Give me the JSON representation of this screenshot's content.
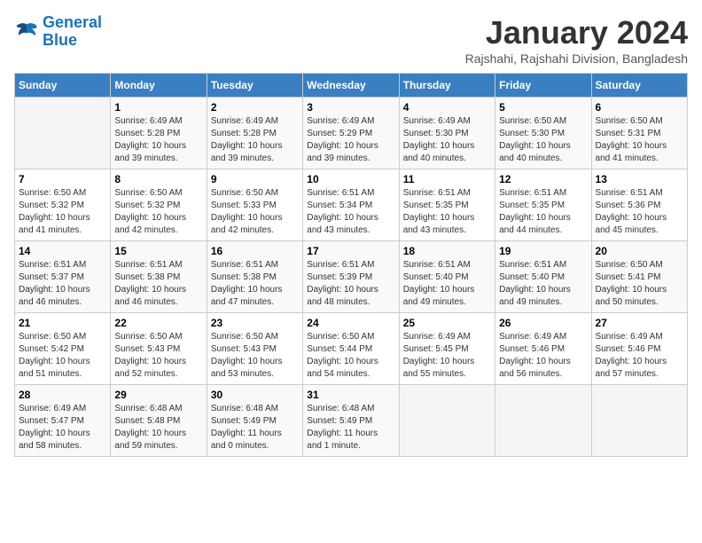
{
  "header": {
    "logo_line1": "General",
    "logo_line2": "Blue",
    "title": "January 2024",
    "subtitle": "Rajshahi, Rajshahi Division, Bangladesh"
  },
  "weekdays": [
    "Sunday",
    "Monday",
    "Tuesday",
    "Wednesday",
    "Thursday",
    "Friday",
    "Saturday"
  ],
  "weeks": [
    [
      {
        "day": "",
        "info": ""
      },
      {
        "day": "1",
        "info": "Sunrise: 6:49 AM\nSunset: 5:28 PM\nDaylight: 10 hours\nand 39 minutes."
      },
      {
        "day": "2",
        "info": "Sunrise: 6:49 AM\nSunset: 5:28 PM\nDaylight: 10 hours\nand 39 minutes."
      },
      {
        "day": "3",
        "info": "Sunrise: 6:49 AM\nSunset: 5:29 PM\nDaylight: 10 hours\nand 39 minutes."
      },
      {
        "day": "4",
        "info": "Sunrise: 6:49 AM\nSunset: 5:30 PM\nDaylight: 10 hours\nand 40 minutes."
      },
      {
        "day": "5",
        "info": "Sunrise: 6:50 AM\nSunset: 5:30 PM\nDaylight: 10 hours\nand 40 minutes."
      },
      {
        "day": "6",
        "info": "Sunrise: 6:50 AM\nSunset: 5:31 PM\nDaylight: 10 hours\nand 41 minutes."
      }
    ],
    [
      {
        "day": "7",
        "info": "Sunrise: 6:50 AM\nSunset: 5:32 PM\nDaylight: 10 hours\nand 41 minutes."
      },
      {
        "day": "8",
        "info": "Sunrise: 6:50 AM\nSunset: 5:32 PM\nDaylight: 10 hours\nand 42 minutes."
      },
      {
        "day": "9",
        "info": "Sunrise: 6:50 AM\nSunset: 5:33 PM\nDaylight: 10 hours\nand 42 minutes."
      },
      {
        "day": "10",
        "info": "Sunrise: 6:51 AM\nSunset: 5:34 PM\nDaylight: 10 hours\nand 43 minutes."
      },
      {
        "day": "11",
        "info": "Sunrise: 6:51 AM\nSunset: 5:35 PM\nDaylight: 10 hours\nand 43 minutes."
      },
      {
        "day": "12",
        "info": "Sunrise: 6:51 AM\nSunset: 5:35 PM\nDaylight: 10 hours\nand 44 minutes."
      },
      {
        "day": "13",
        "info": "Sunrise: 6:51 AM\nSunset: 5:36 PM\nDaylight: 10 hours\nand 45 minutes."
      }
    ],
    [
      {
        "day": "14",
        "info": "Sunrise: 6:51 AM\nSunset: 5:37 PM\nDaylight: 10 hours\nand 46 minutes."
      },
      {
        "day": "15",
        "info": "Sunrise: 6:51 AM\nSunset: 5:38 PM\nDaylight: 10 hours\nand 46 minutes."
      },
      {
        "day": "16",
        "info": "Sunrise: 6:51 AM\nSunset: 5:38 PM\nDaylight: 10 hours\nand 47 minutes."
      },
      {
        "day": "17",
        "info": "Sunrise: 6:51 AM\nSunset: 5:39 PM\nDaylight: 10 hours\nand 48 minutes."
      },
      {
        "day": "18",
        "info": "Sunrise: 6:51 AM\nSunset: 5:40 PM\nDaylight: 10 hours\nand 49 minutes."
      },
      {
        "day": "19",
        "info": "Sunrise: 6:51 AM\nSunset: 5:40 PM\nDaylight: 10 hours\nand 49 minutes."
      },
      {
        "day": "20",
        "info": "Sunrise: 6:50 AM\nSunset: 5:41 PM\nDaylight: 10 hours\nand 50 minutes."
      }
    ],
    [
      {
        "day": "21",
        "info": "Sunrise: 6:50 AM\nSunset: 5:42 PM\nDaylight: 10 hours\nand 51 minutes."
      },
      {
        "day": "22",
        "info": "Sunrise: 6:50 AM\nSunset: 5:43 PM\nDaylight: 10 hours\nand 52 minutes."
      },
      {
        "day": "23",
        "info": "Sunrise: 6:50 AM\nSunset: 5:43 PM\nDaylight: 10 hours\nand 53 minutes."
      },
      {
        "day": "24",
        "info": "Sunrise: 6:50 AM\nSunset: 5:44 PM\nDaylight: 10 hours\nand 54 minutes."
      },
      {
        "day": "25",
        "info": "Sunrise: 6:49 AM\nSunset: 5:45 PM\nDaylight: 10 hours\nand 55 minutes."
      },
      {
        "day": "26",
        "info": "Sunrise: 6:49 AM\nSunset: 5:46 PM\nDaylight: 10 hours\nand 56 minutes."
      },
      {
        "day": "27",
        "info": "Sunrise: 6:49 AM\nSunset: 5:46 PM\nDaylight: 10 hours\nand 57 minutes."
      }
    ],
    [
      {
        "day": "28",
        "info": "Sunrise: 6:49 AM\nSunset: 5:47 PM\nDaylight: 10 hours\nand 58 minutes."
      },
      {
        "day": "29",
        "info": "Sunrise: 6:48 AM\nSunset: 5:48 PM\nDaylight: 10 hours\nand 59 minutes."
      },
      {
        "day": "30",
        "info": "Sunrise: 6:48 AM\nSunset: 5:49 PM\nDaylight: 11 hours\nand 0 minutes."
      },
      {
        "day": "31",
        "info": "Sunrise: 6:48 AM\nSunset: 5:49 PM\nDaylight: 11 hours\nand 1 minute."
      },
      {
        "day": "",
        "info": ""
      },
      {
        "day": "",
        "info": ""
      },
      {
        "day": "",
        "info": ""
      }
    ]
  ]
}
